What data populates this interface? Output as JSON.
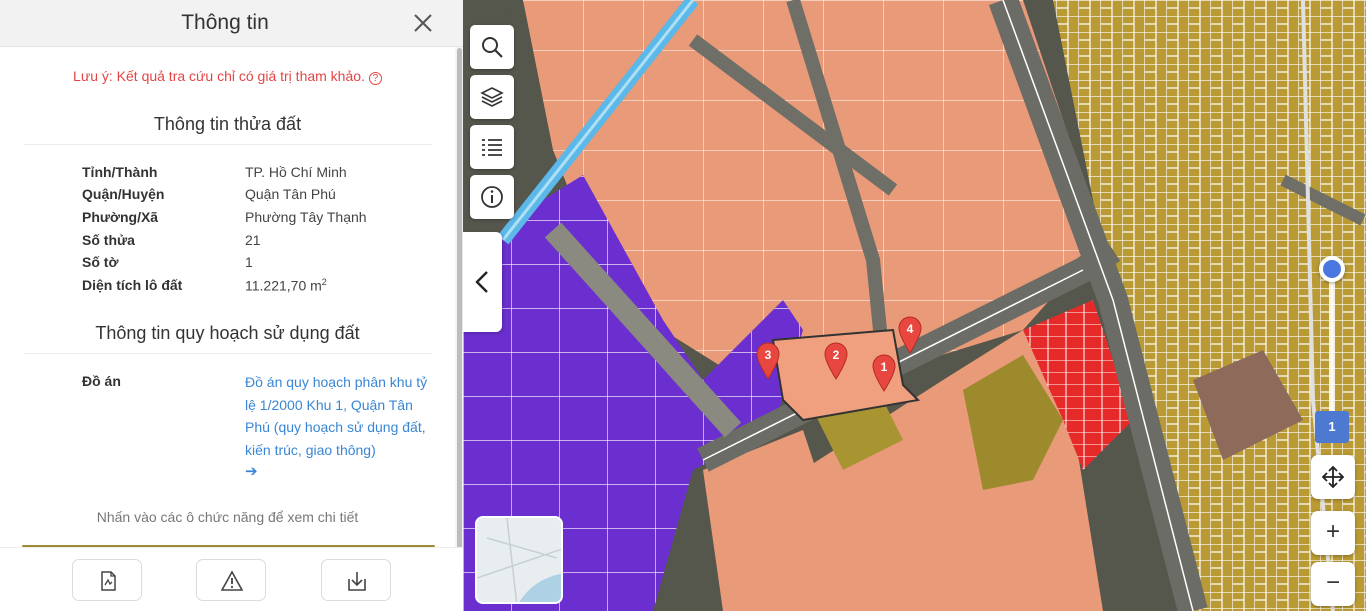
{
  "panel": {
    "title": "Thông tin",
    "warning": "Lưu ý: Kết quả tra cứu chỉ có giá trị tham khảo.",
    "parcel_section_title": "Thông tin thửa đất",
    "parcel_rows": [
      {
        "label": "Tỉnh/Thành",
        "value": "TP. Hồ Chí Minh"
      },
      {
        "label": "Quận/Huyện",
        "value": "Quận Tân Phú"
      },
      {
        "label": "Phường/Xã",
        "value": "Phường Tây Thạnh"
      },
      {
        "label": "Số thửa",
        "value": "21"
      },
      {
        "label": "Số tờ",
        "value": "1"
      },
      {
        "label": "Diện tích lô đất",
        "value": "11.221,70 m",
        "unit_sup": "2"
      }
    ],
    "planning_section_title": "Thông tin quy hoạch sử dụng đất",
    "plan_label": "Đồ án",
    "plan_link": "Đồ án quy hoạch phân khu tỷ lệ 1/2000 Khu 1, Quận Tân Phú (quy hoạch sử dụng đất, kiến trúc, giao thông)",
    "arrow": "➔",
    "hint": "Nhấn vào các ô chức năng để xem chi tiết"
  },
  "map": {
    "markers": [
      "1",
      "2",
      "3",
      "4"
    ],
    "layer_badge": "1",
    "zoom_in": "+",
    "zoom_out": "−",
    "colors": {
      "residential": "#c9a23a",
      "commercial_orange": "#f2a27f",
      "industrial_purple": "#7a3bd6",
      "red_zone": "#e8282a",
      "olive_zone": "#a08d2c",
      "canal": "#5bb8e8",
      "marker": "#e8473f"
    }
  },
  "icons": [
    "close-icon",
    "help-icon",
    "search-icon",
    "layers-icon",
    "list-icon",
    "info-icon",
    "chevron-left-icon",
    "document-icon",
    "warning-icon",
    "download-icon",
    "move-icon"
  ]
}
